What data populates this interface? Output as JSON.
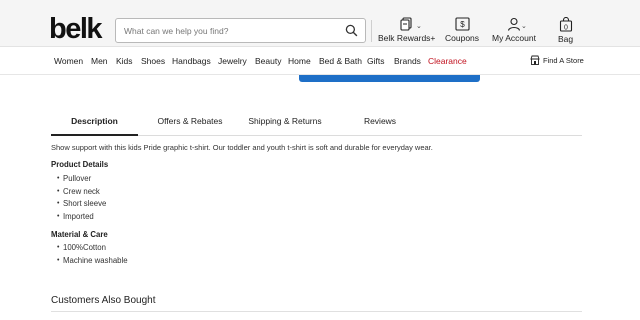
{
  "header": {
    "logo": "belk",
    "search_placeholder": "What can we help you find?",
    "rewards_label": "Belk Rewards+",
    "coupons_label": "Coupons",
    "account_label": "My Account",
    "bag_label": "Bag",
    "bag_count": "0"
  },
  "nav": {
    "items": [
      "Women",
      "Men",
      "Kids",
      "Shoes",
      "Handbags",
      "Jewelry",
      "Beauty",
      "Home",
      "Bed & Bath",
      "Gifts",
      "Brands",
      "Clearance"
    ],
    "clearance_color": "#c1121f",
    "find_store": "Find A Store"
  },
  "tabs": [
    "Description",
    "Offers & Rebates",
    "Shipping & Returns",
    "Reviews"
  ],
  "content": {
    "description": "Show support with this kids Pride graphic t-shirt. Our toddler and youth t-shirt is soft and durable for everyday wear.",
    "details_title": "Product Details",
    "details": [
      "Pullover",
      "Crew neck",
      "Short sleeve",
      "Imported"
    ],
    "material_title": "Material & Care",
    "material": [
      "100%Cotton",
      "Machine washable"
    ],
    "also_bought": "Customers Also Bought"
  },
  "colors": {
    "accent_blue": "#1e6fc7",
    "header_bg": "#f5f5f5"
  }
}
